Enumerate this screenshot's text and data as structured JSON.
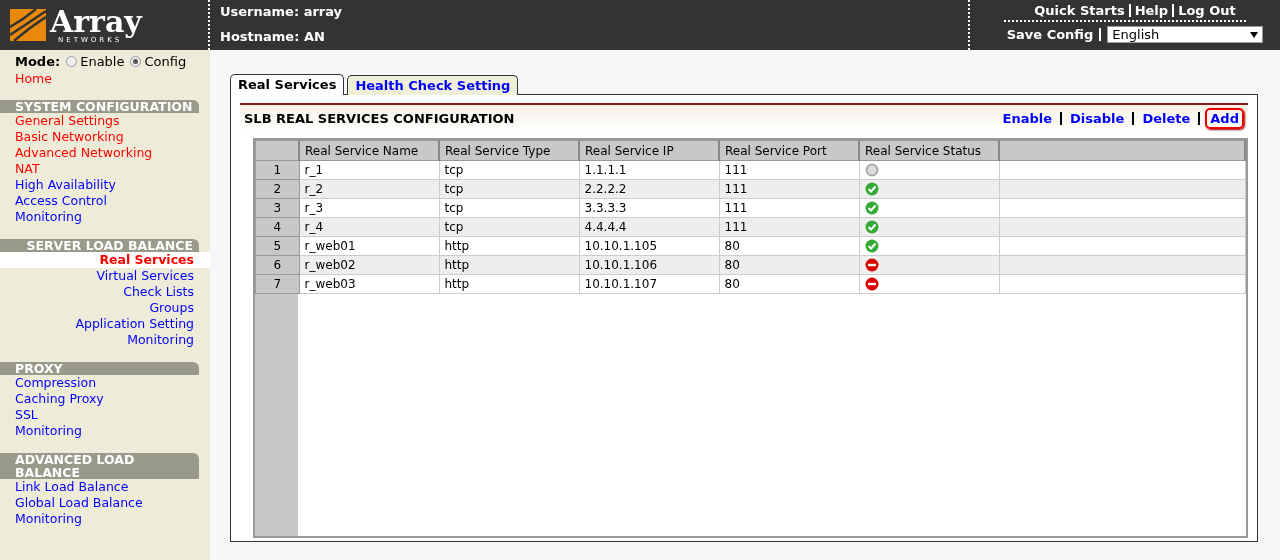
{
  "header": {
    "logo": {
      "name": "Array",
      "sub": "NETWORKS"
    },
    "username": "Username: array",
    "hostname": "Hostname: AN",
    "links": [
      "Quick Starts",
      "Help",
      "Log Out"
    ],
    "save": "Save Config",
    "language": "English"
  },
  "mode": {
    "label": "Mode:",
    "options": [
      {
        "label": "Enable",
        "selected": false
      },
      {
        "label": "Config",
        "selected": true
      }
    ]
  },
  "home": {
    "label": "Home",
    "color": "#ff0000"
  },
  "sidebar": {
    "sections": [
      {
        "title": "SYSTEM CONFIGURATION",
        "kind": "left",
        "items": [
          {
            "label": "General Settings",
            "color": "#ff0000",
            "selected": false
          },
          {
            "label": "Basic Networking",
            "color": "#ff0000",
            "selected": false
          },
          {
            "label": "Advanced Networking",
            "color": "#ff0000",
            "selected": false
          },
          {
            "label": "NAT",
            "color": "#ff0000",
            "selected": false
          },
          {
            "label": "High Availability",
            "color": "#0000ff",
            "selected": false
          },
          {
            "label": "Access Control",
            "color": "#0000ff",
            "selected": false
          },
          {
            "label": "Monitoring",
            "color": "#0000ff",
            "selected": false
          }
        ]
      },
      {
        "title": "SERVER LOAD BALANCE",
        "kind": "right",
        "items": [
          {
            "label": "Real Services",
            "color": "#ff0000",
            "selected": true
          },
          {
            "label": "Virtual Services",
            "color": "#0000ff",
            "selected": false
          },
          {
            "label": "Check Lists",
            "color": "#0000ff",
            "selected": false
          },
          {
            "label": "Groups",
            "color": "#0000ff",
            "selected": false
          },
          {
            "label": "Application Setting",
            "color": "#0000ff",
            "selected": false
          },
          {
            "label": "Monitoring",
            "color": "#0000ff",
            "selected": false
          }
        ]
      },
      {
        "title": "PROXY",
        "kind": "left",
        "items": [
          {
            "label": "Compression",
            "color": "#0000ff",
            "selected": false
          },
          {
            "label": "Caching Proxy",
            "color": "#0000ff",
            "selected": false
          },
          {
            "label": "SSL",
            "color": "#0000ff",
            "selected": false
          },
          {
            "label": "Monitoring",
            "color": "#0000ff",
            "selected": false
          }
        ]
      },
      {
        "title": "ADVANCED LOAD BALANCE",
        "kind": "left",
        "items": [
          {
            "label": "Link Load Balance",
            "color": "#0000ff",
            "selected": false
          },
          {
            "label": "Global Load Balance",
            "color": "#0000ff",
            "selected": false
          },
          {
            "label": "Monitoring",
            "color": "#0000ff",
            "selected": false
          }
        ]
      }
    ]
  },
  "tabs": [
    {
      "label": "Real Services",
      "selected": true
    },
    {
      "label": "Health Check Setting",
      "selected": false
    }
  ],
  "panel": {
    "title": "SLB REAL SERVICES CONFIGURATION",
    "actions": [
      {
        "label": "Enable",
        "highlighted": false
      },
      {
        "label": "Disable",
        "highlighted": false
      },
      {
        "label": "Delete",
        "highlighted": false
      },
      {
        "label": "Add",
        "highlighted": true
      }
    ]
  },
  "table": {
    "columns": [
      "Real Service Name",
      "Real Service Type",
      "Real Service IP",
      "Real Service Port",
      "Real Service Status"
    ],
    "rows": [
      {
        "index": "1",
        "name": "r_1",
        "type": "tcp",
        "ip": "1.1.1.1",
        "port": "111",
        "kind": "unknown"
      },
      {
        "index": "2",
        "name": "r_2",
        "type": "tcp",
        "ip": "2.2.2.2",
        "port": "111",
        "kind": "up"
      },
      {
        "index": "3",
        "name": "r_3",
        "type": "tcp",
        "ip": "3.3.3.3",
        "port": "111",
        "kind": "up"
      },
      {
        "index": "4",
        "name": "r_4",
        "type": "tcp",
        "ip": "4.4.4.4",
        "port": "111",
        "kind": "up"
      },
      {
        "index": "5",
        "name": "r_web01",
        "type": "http",
        "ip": "10.10.1.105",
        "port": "80",
        "kind": "up"
      },
      {
        "index": "6",
        "name": "r_web02",
        "type": "http",
        "ip": "10.10.1.106",
        "port": "80",
        "kind": "down"
      },
      {
        "index": "7",
        "name": "r_web03",
        "type": "http",
        "ip": "10.10.1.107",
        "port": "80",
        "kind": "down"
      }
    ]
  }
}
